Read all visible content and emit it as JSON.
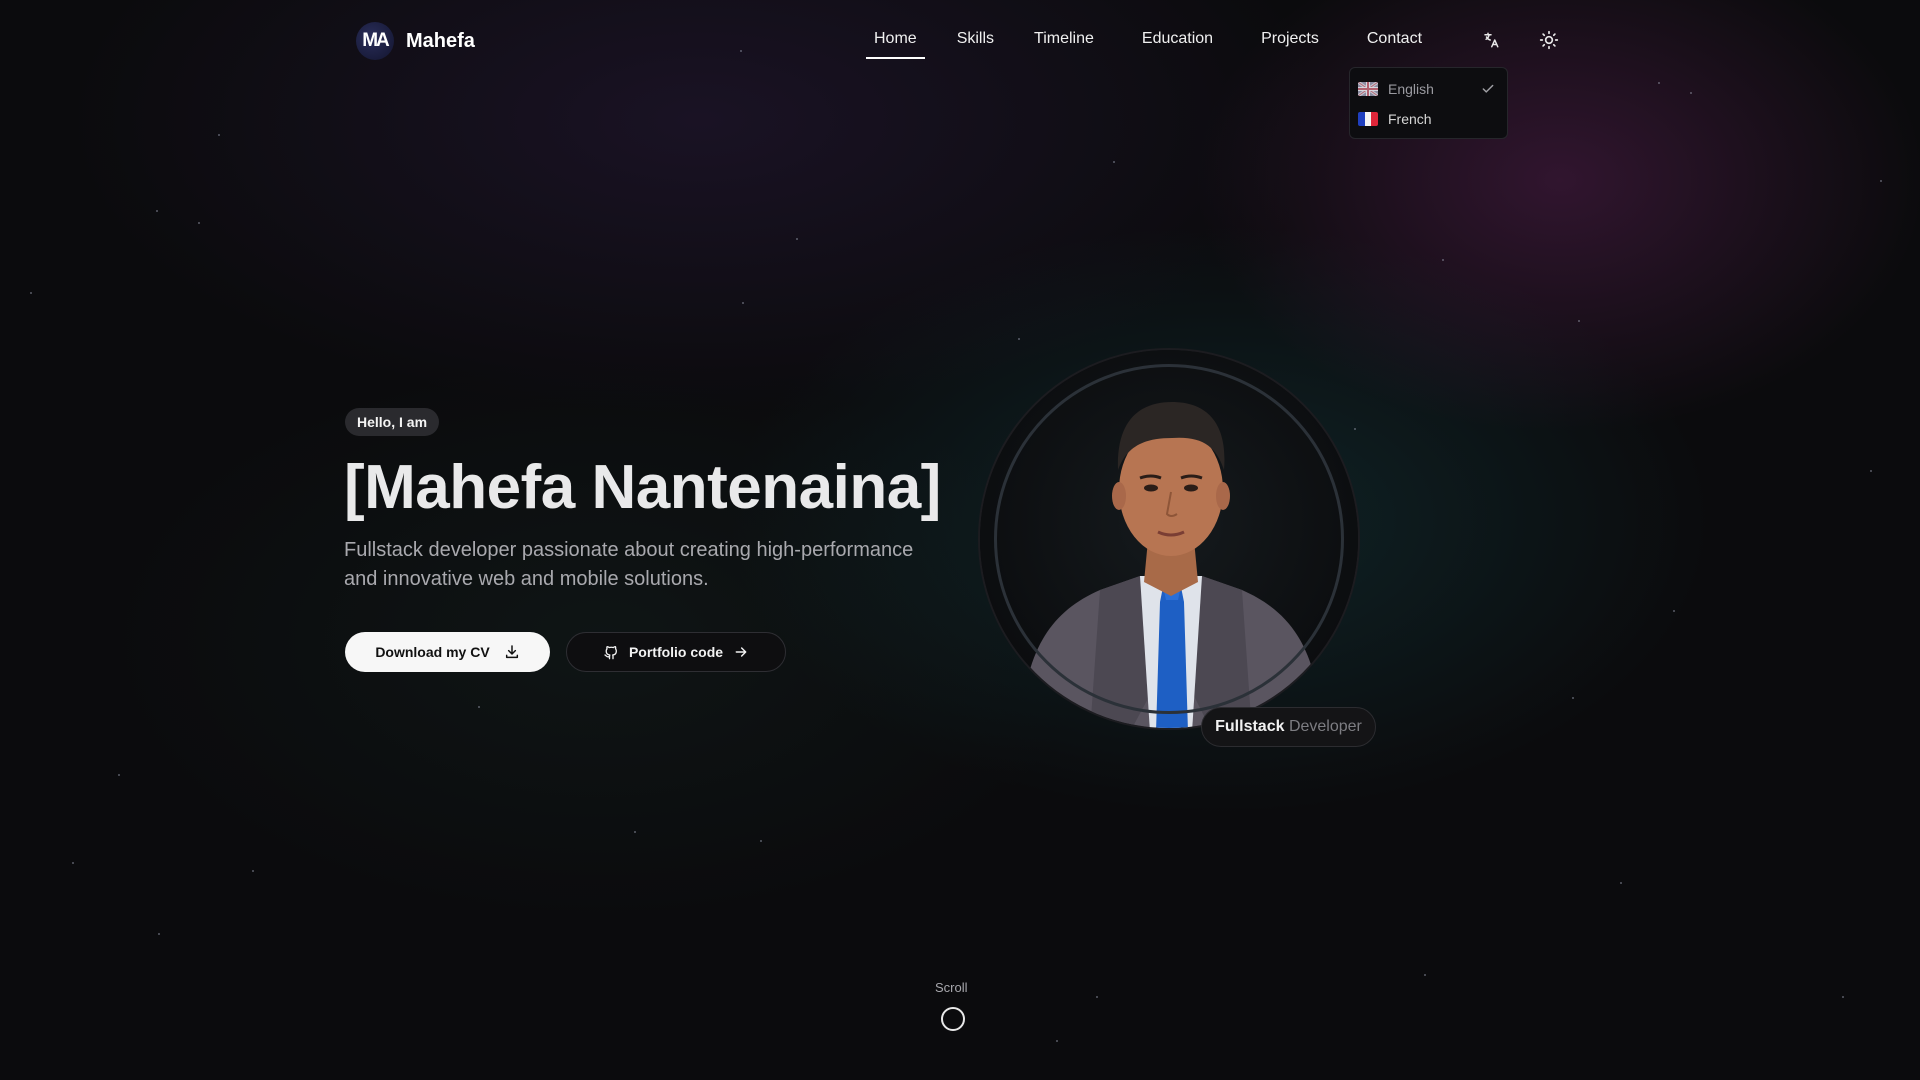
{
  "header": {
    "logo_mark": "MA",
    "logo_text": "Mahefa",
    "nav": [
      {
        "label": "Home",
        "active": true
      },
      {
        "label": "Skills"
      },
      {
        "label": "Timeline"
      },
      {
        "label": "Education"
      },
      {
        "label": "Projects"
      },
      {
        "label": "Contact"
      }
    ],
    "icons": {
      "language": "translate-icon",
      "theme": "sun-icon"
    }
  },
  "language_menu": {
    "items": [
      {
        "label": "English",
        "flag": "uk-flag-icon",
        "selected": true
      },
      {
        "label": "French",
        "flag": "france-flag-icon",
        "selected": false
      }
    ]
  },
  "hero": {
    "badge": "Hello, I am",
    "title": "[Mahefa Nantenaina]",
    "subtitle": "Fullstack developer passionate about creating high-performance and innovative web and mobile solutions.",
    "cv_button": "Download my CV",
    "code_button": "Portfolio code",
    "role_chip_main": "Fullstack",
    "role_chip_faded": "Developer"
  },
  "scroll": {
    "label": "Scroll"
  },
  "colors": {
    "background": "#0b0b0d",
    "accent_purple": "#5a2a6a",
    "accent_teal": "#144b50",
    "text": "#f2f2f2",
    "muted": "#a9a9ae"
  }
}
